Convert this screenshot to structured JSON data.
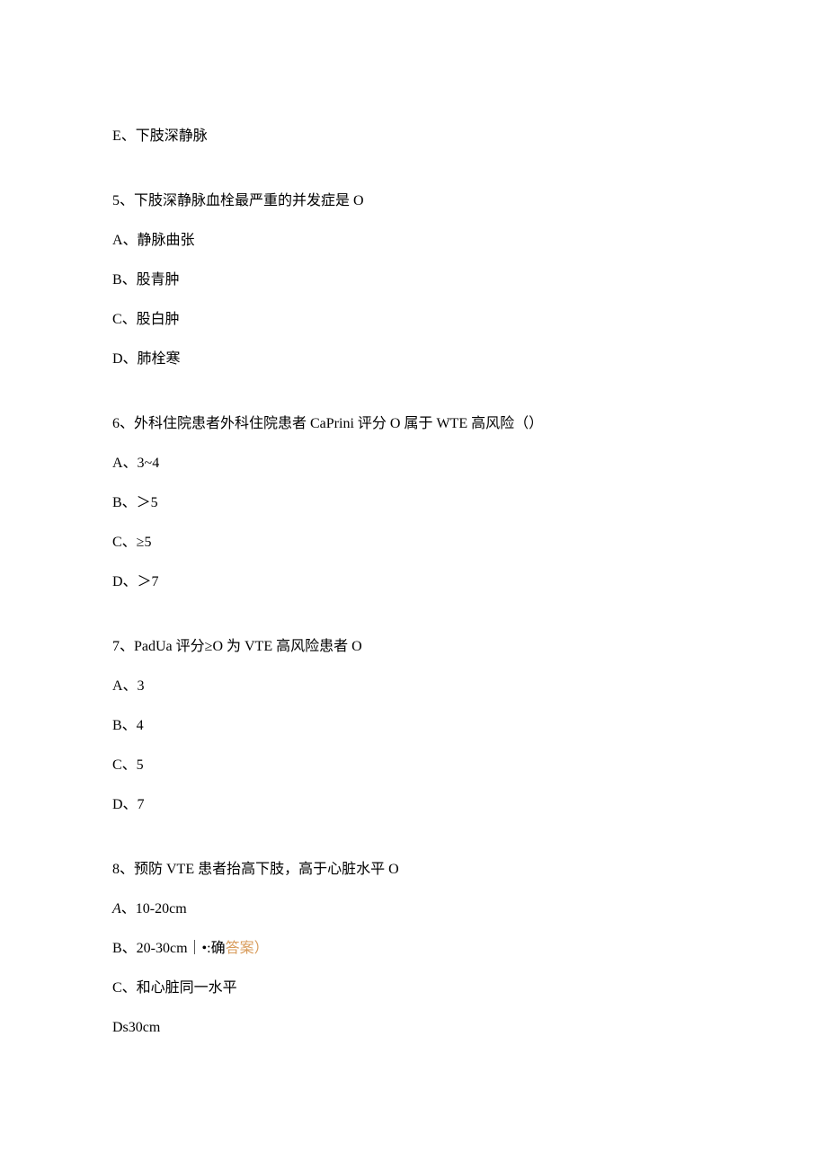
{
  "q4_continued": {
    "optE": "E、下肢深静脉"
  },
  "q5": {
    "stem": "5、下肢深静脉血栓最严重的并发症是 O",
    "optA": "A、静脉曲张",
    "optB": "B、股青肿",
    "optC": "C、股白肿",
    "optD": "D、肺栓寒"
  },
  "q6": {
    "stem_prefix": "6、外科住院患者外科住院患者 CaPrini 评分 O 属于 WTE 高风险（）",
    "optA": "A、3~4",
    "optB": "B、＞5",
    "optC": "C、≥5",
    "optD": "D、＞7"
  },
  "q7": {
    "stem": "7、PadUa 评分≥O 为 VTE 高风险患者 O",
    "optA": "A、3",
    "optB": "B、4",
    "optC": "C、5",
    "optD": "D、7"
  },
  "q8": {
    "stem": "8、预防 VTE 患者抬高下肢，高于心脏水平 O",
    "optA_prefix": "A",
    "optA_text": "、10-20cm",
    "optB_text": "B、20-30cm｜•:确",
    "optB_mark": "答案）",
    "optC": "C、和心脏同一水平",
    "optD": "Ds30cm"
  }
}
